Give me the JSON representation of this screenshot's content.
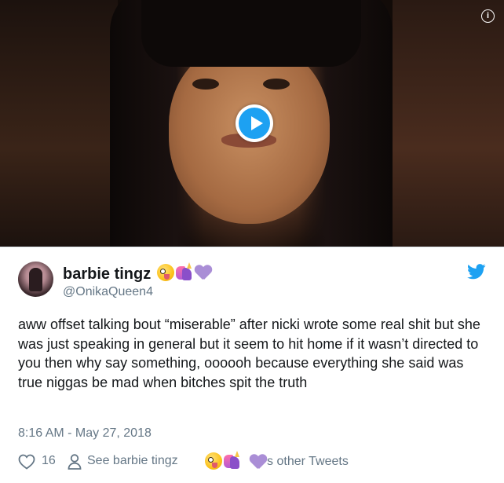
{
  "tweet": {
    "display_name": "barbie tingz",
    "name_emojis": [
      "zany-face-emoji",
      "unicorn-emoji",
      "purple-heart-emoji"
    ],
    "handle": "@OnikaQueen4",
    "text": "aww offset talking bout “miserable” after nicki wrote some real shit but she was just speaking in general but it seem to hit home if it wasn’t directed to you then why say something, oooooh because everything she said was true niggas be mad when bitches spit the truth",
    "timestamp": "8:16 AM - May 27, 2018",
    "like_count": "16",
    "see_prefix": "See barbie tingz",
    "see_suffix": "'s other Tweets"
  },
  "media": {
    "type": "video",
    "info_label": "i"
  },
  "colors": {
    "brand": "#1da1f2",
    "secondary_text": "#657786",
    "primary_text": "#14171a",
    "divider": "#e1e8ed"
  },
  "icons": {
    "play": "play-icon",
    "info": "info-icon",
    "bird": "twitter-bird-icon",
    "like": "heart-outline-icon",
    "profile": "person-icon"
  }
}
